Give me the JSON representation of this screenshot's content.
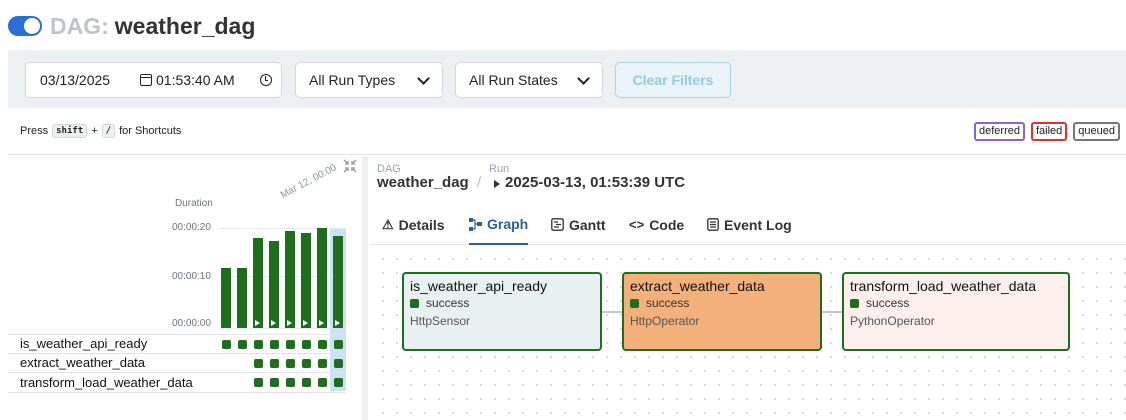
{
  "header": {
    "prefix": "DAG:",
    "dag_id": "weather_dag",
    "toggle_state": "on",
    "accent": "#2b6fd6"
  },
  "filters": {
    "date": "03/13/2025",
    "time": "01:53:40 AM",
    "run_types": "All Run Types",
    "run_states": "All Run States",
    "clear_label": "Clear Filters"
  },
  "shortcut": {
    "press": "Press",
    "key1": "shift",
    "plus": "+",
    "key2": "/",
    "suffix": "for Shortcuts"
  },
  "legend": {
    "deferred": "deferred",
    "failed": "failed",
    "queued": "queued"
  },
  "grid": {
    "duration_label": "Duration",
    "run_date_label": "Mar 12, 00:00",
    "ticks": [
      "00:00:20",
      "00:00:10",
      "00:00:00"
    ],
    "durations_sec": [
      12,
      12,
      18,
      17.5,
      19.5,
      19,
      20,
      18.5
    ],
    "tasks": [
      {
        "name": "is_weather_api_ready",
        "runs": 8
      },
      {
        "name": "extract_weather_data",
        "runs": 6
      },
      {
        "name": "transform_load_weather_data",
        "runs": 6
      }
    ],
    "success_color": "#1e6e1e"
  },
  "breadcrumb": {
    "dag_label": "DAG",
    "dag_value": "weather_dag",
    "sep": "/",
    "run_label": "Run",
    "run_value": "2025-03-13, 01:53:39 UTC"
  },
  "tabs": [
    {
      "label": "Details",
      "icon": "warning-icon"
    },
    {
      "label": "Graph",
      "icon": "graph-icon"
    },
    {
      "label": "Gantt",
      "icon": "gantt-icon"
    },
    {
      "label": "Code",
      "icon": "code-icon"
    },
    {
      "label": "Event Log",
      "icon": "log-icon"
    }
  ],
  "nodes": [
    {
      "name": "is_weather_api_ready",
      "state": "success",
      "operator": "HttpSensor"
    },
    {
      "name": "extract_weather_data",
      "state": "success",
      "operator": "HttpOperator"
    },
    {
      "name": "transform_load_weather_data",
      "state": "success",
      "operator": "PythonOperator"
    }
  ]
}
